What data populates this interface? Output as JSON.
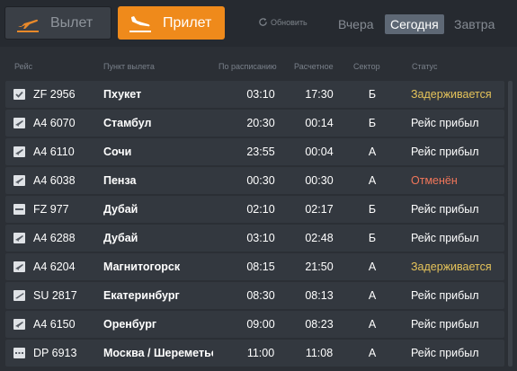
{
  "tabs": {
    "departure": "Вылет",
    "arrival": "Прилет"
  },
  "refresh_label": "Обновить",
  "days": {
    "yesterday": "Вчера",
    "today": "Сегодня",
    "tomorrow": "Завтра"
  },
  "headers": {
    "flight": "Рейс",
    "from": "Пункт вылета",
    "scheduled": "По расписанию",
    "estimated": "Расчетное",
    "sector": "Сектор",
    "status": "Статус"
  },
  "flights": [
    {
      "icon": "check",
      "flight": "ZF 2956",
      "from": "Пхукет",
      "scheduled": "03:10",
      "estimated": "17:30",
      "sector": "Б",
      "status": "Задерживается",
      "status_type": "delay"
    },
    {
      "icon": "plane",
      "flight": "A4 6070",
      "from": "Стамбул",
      "scheduled": "20:30",
      "estimated": "00:14",
      "sector": "Б",
      "status": "Рейс прибыл",
      "status_type": "landed"
    },
    {
      "icon": "plane",
      "flight": "A4 6110",
      "from": "Сочи",
      "scheduled": "23:55",
      "estimated": "00:04",
      "sector": "А",
      "status": "Рейс прибыл",
      "status_type": "landed"
    },
    {
      "icon": "plane",
      "flight": "A4 6038",
      "from": "Пенза",
      "scheduled": "00:30",
      "estimated": "00:30",
      "sector": "А",
      "status": "Отменён",
      "status_type": "cancel"
    },
    {
      "icon": "dash",
      "flight": "FZ 977",
      "from": "Дубай",
      "scheduled": "02:10",
      "estimated": "02:17",
      "sector": "Б",
      "status": "Рейс прибыл",
      "status_type": "landed"
    },
    {
      "icon": "plane",
      "flight": "A4 6288",
      "from": "Дубай",
      "scheduled": "03:10",
      "estimated": "02:48",
      "sector": "Б",
      "status": "Рейс прибыл",
      "status_type": "landed"
    },
    {
      "icon": "plane",
      "flight": "A4 6204",
      "from": "Магнитогорск",
      "scheduled": "08:15",
      "estimated": "21:50",
      "sector": "А",
      "status": "Задерживается",
      "status_type": "delay"
    },
    {
      "icon": "plane2",
      "flight": "SU 2817",
      "from": "Екатеринбург",
      "scheduled": "08:30",
      "estimated": "08:13",
      "sector": "А",
      "status": "Рейс прибыл",
      "status_type": "landed"
    },
    {
      "icon": "plane",
      "flight": "A4 6150",
      "from": "Оренбург",
      "scheduled": "09:00",
      "estimated": "08:23",
      "sector": "А",
      "status": "Рейс прибыл",
      "status_type": "landed"
    },
    {
      "icon": "dots",
      "flight": "DP 6913",
      "from": "Москва / Шереметьево",
      "scheduled": "11:00",
      "estimated": "11:08",
      "sector": "А",
      "status": "Рейс прибыл",
      "status_type": "landed"
    }
  ]
}
